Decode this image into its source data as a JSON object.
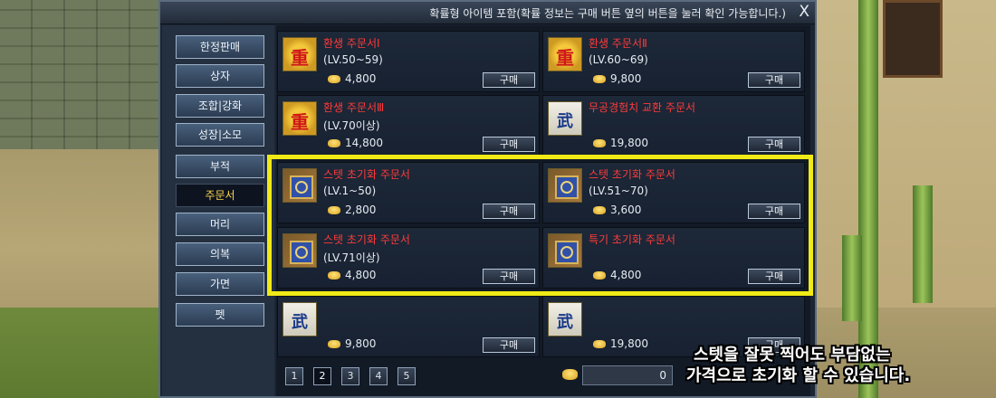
{
  "window": {
    "title": "확률형 아이템 포함(확률 정보는 구매 버튼 옆의 버튼을 눌러 확인 가능합니다.)",
    "close_label": "X"
  },
  "sidebar": {
    "items": [
      {
        "label": "한정판매"
      },
      {
        "label": "상자"
      },
      {
        "label": "조합|강화"
      },
      {
        "label": "성장|소모"
      },
      {
        "label": "부적"
      },
      {
        "label": "주문서",
        "active": true
      },
      {
        "label": "머리"
      },
      {
        "label": "의복"
      },
      {
        "label": "가면"
      },
      {
        "label": "펫"
      }
    ]
  },
  "items": [
    {
      "name": "환생 주문서Ⅰ",
      "level": "(LV.50~59)",
      "price": "4,800",
      "buy_label": "구매",
      "icon": "scroll-red-icon"
    },
    {
      "name": "환생 주문서Ⅱ",
      "level": "(LV.60~69)",
      "price": "9,800",
      "buy_label": "구매",
      "icon": "scroll-red-icon"
    },
    {
      "name": "환생 주문서Ⅲ",
      "level": "(LV.70이상)",
      "price": "14,800",
      "buy_label": "구매",
      "icon": "scroll-red-icon"
    },
    {
      "name": "무공경험치 교환 주문서",
      "level": "",
      "price": "19,800",
      "buy_label": "구매",
      "icon": "scroll-white-icon"
    },
    {
      "name": "스텟 초기화 주문서",
      "level": "(LV.1~50)",
      "price": "2,800",
      "buy_label": "구매",
      "icon": "mat-icon"
    },
    {
      "name": "스텟 초기화 주문서",
      "level": "(LV.51~70)",
      "price": "3,600",
      "buy_label": "구매",
      "icon": "mat-icon"
    },
    {
      "name": "스텟 초기화 주문서",
      "level": "(LV.71이상)",
      "price": "4,800",
      "buy_label": "구매",
      "icon": "mat-icon"
    },
    {
      "name": "특기 초기화 주문서",
      "level": "",
      "price": "4,800",
      "buy_label": "구매",
      "icon": "mat-icon"
    },
    {
      "name": "",
      "level": "",
      "price": "9,800",
      "buy_label": "구매",
      "icon": "scroll-white-icon"
    },
    {
      "name": "",
      "level": "",
      "price": "19,800",
      "buy_label": "구매",
      "icon": "scroll-white-icon"
    }
  ],
  "pagination": {
    "pages": [
      "1",
      "2",
      "3",
      "4",
      "5"
    ],
    "current": "2"
  },
  "balance": {
    "value": "0"
  },
  "caption": {
    "line1": "스텟을 잘못 찍어도 부담없는",
    "line2": "가격으로 초기화 할 수 있습니다."
  },
  "colors": {
    "highlight": "#f0ea16",
    "item_name": "#ff3b3b",
    "active_category": "#ffd54a"
  }
}
